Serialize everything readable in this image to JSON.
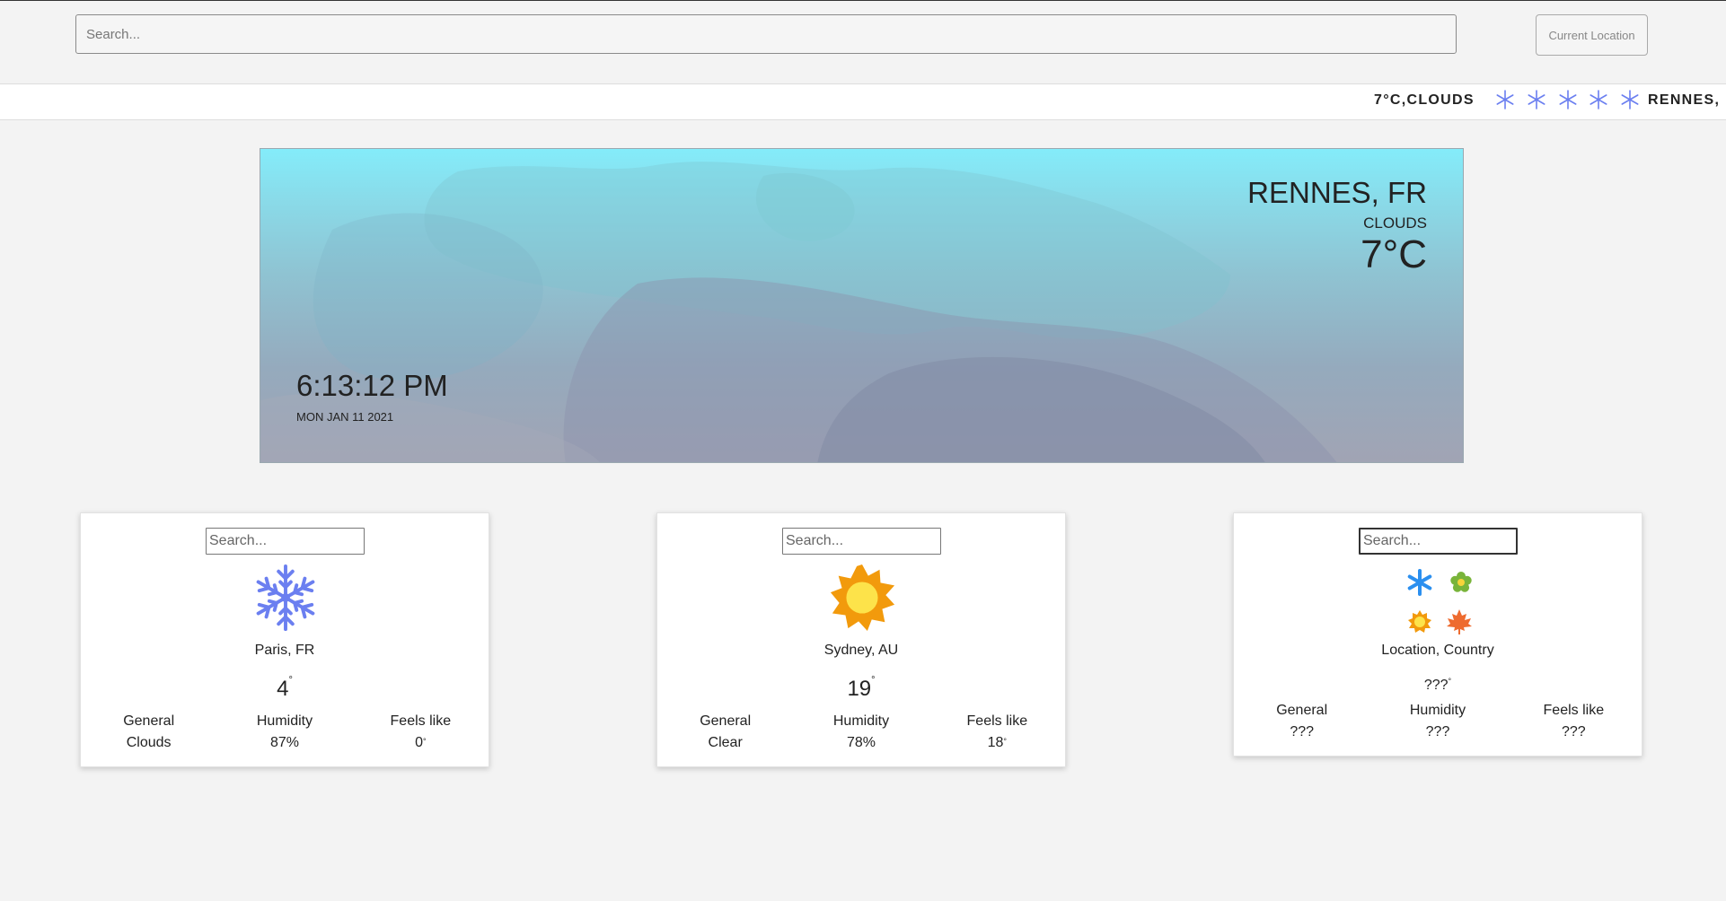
{
  "header": {
    "search_placeholder": "Search...",
    "current_location_label": "Current Location"
  },
  "ticker": {
    "temp_condition": "7°C,CLOUDS",
    "icon_count": 5,
    "icon": "snowflake-icon",
    "city": "RENNES, I"
  },
  "hero": {
    "city": "RENNES, FR",
    "condition": "CLOUDS",
    "temperature": "7°C",
    "time": "6:13:12 PM",
    "date": "MON JAN 11 2021"
  },
  "cards": [
    {
      "search_placeholder": "Search...",
      "icon": "snowflake-icon",
      "location": "Paris, FR",
      "temperature": "4",
      "degree": "°",
      "general_label": "General",
      "general_value": "Clouds",
      "humidity_label": "Humidity",
      "humidity_value": "87%",
      "feels_label": "Feels like",
      "feels_value": "0",
      "feels_degree": "°"
    },
    {
      "search_placeholder": "Search...",
      "icon": "sun-icon",
      "location": "Sydney, AU",
      "temperature": "19",
      "degree": "°",
      "general_label": "General",
      "general_value": "Clear",
      "humidity_label": "Humidity",
      "humidity_value": "78%",
      "feels_label": "Feels like",
      "feels_value": "18",
      "feels_degree": "°"
    },
    {
      "search_placeholder": "Search...",
      "icons": [
        "snowflake-icon",
        "flower-icon",
        "sun-icon",
        "maple-leaf-icon"
      ],
      "location": "Location, Country",
      "temperature": "???",
      "degree": "°",
      "general_label": "General",
      "general_value": "???",
      "humidity_label": "Humidity",
      "humidity_value": "???",
      "feels_label": "Feels like",
      "feels_value": "???"
    }
  ],
  "colors": {
    "snowflake": "#6b7ff0",
    "sun_outer": "#f29a0c",
    "sun_inner": "#fde34a",
    "season_snow": "#2b8fef",
    "season_flower": "#79b43a",
    "season_leaf": "#ee6b2f"
  }
}
